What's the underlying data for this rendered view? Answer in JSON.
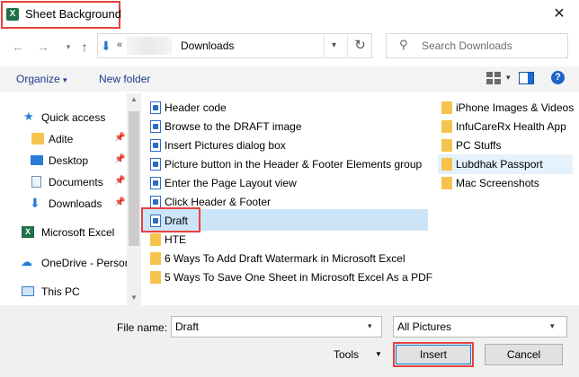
{
  "window": {
    "title": "Sheet Background",
    "close_glyph": "✕"
  },
  "address": {
    "separator": "«",
    "current_folder": "Downloads",
    "search_placeholder": "Search Downloads"
  },
  "toolbar": {
    "organize": "Organize",
    "new_folder": "New folder"
  },
  "nav": {
    "items": [
      {
        "label": "Quick access",
        "icon": "star-icon"
      },
      {
        "label": "Adite",
        "icon": "folder-icon",
        "pinned": true
      },
      {
        "label": "Desktop",
        "icon": "desktop-icon",
        "pinned": true
      },
      {
        "label": "Documents",
        "icon": "documents-icon",
        "pinned": true
      },
      {
        "label": "Downloads",
        "icon": "downloads-icon",
        "pinned": true
      },
      {
        "label": "Microsoft Excel",
        "icon": "excel-icon"
      },
      {
        "label": "OneDrive - Persor",
        "icon": "cloud-icon"
      },
      {
        "label": "This PC",
        "icon": "pc-icon"
      }
    ]
  },
  "files": {
    "column1": [
      {
        "name": "Header code",
        "type": "doc"
      },
      {
        "name": "Browse to the DRAFT image",
        "type": "doc"
      },
      {
        "name": "Insert Pictures dialog box",
        "type": "doc"
      },
      {
        "name": "Picture button in the Header & Footer Elements group",
        "type": "doc"
      },
      {
        "name": "Enter the Page Layout view",
        "type": "doc"
      },
      {
        "name": "Click Header & Footer",
        "type": "doc"
      },
      {
        "name": "Draft",
        "type": "doc"
      },
      {
        "name": "HTE",
        "type": "folder"
      },
      {
        "name": "6 Ways To Add Draft Watermark in Microsoft Excel",
        "type": "folder"
      },
      {
        "name": "5 Ways To Save One Sheet in Microsoft Excel As a PDF",
        "type": "folder"
      }
    ],
    "column2": [
      {
        "name": "iPhone Images & Videos",
        "type": "folder"
      },
      {
        "name": "InfuCareRx Health App",
        "type": "folder"
      },
      {
        "name": "PC Stuffs",
        "type": "folder"
      },
      {
        "name": "Lubdhak Passport",
        "type": "folder"
      },
      {
        "name": "Mac Screenshots",
        "type": "folder"
      }
    ]
  },
  "footer": {
    "file_name_label": "File name:",
    "file_name_value": "Draft",
    "filter_value": "All Pictures",
    "tools_label": "Tools",
    "insert_label": "Insert",
    "cancel_label": "Cancel"
  },
  "colors": {
    "highlight_red": "#e8413d",
    "selection_blue": "#cce4f7",
    "link_blue": "#1a3a8a",
    "folder_yellow": "#f6c34f"
  }
}
